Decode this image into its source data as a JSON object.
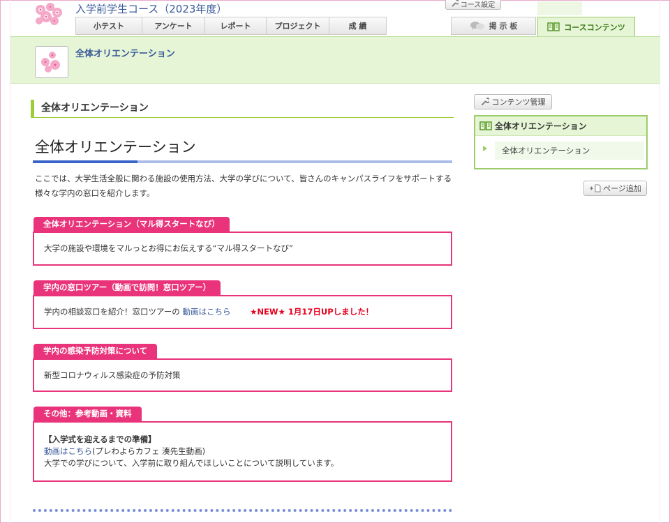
{
  "header": {
    "course_title": "入学前学生コース（2023年度）",
    "course_settings": "コース設定",
    "tabs": [
      {
        "label": "小テスト"
      },
      {
        "label": "アンケート"
      },
      {
        "label": "レポート"
      },
      {
        "label": "プロジェクト"
      },
      {
        "label": "成 績"
      }
    ],
    "board_tab": "掲 示 板",
    "contents_tab": "コースコンテンツ"
  },
  "band": {
    "title": "全体オリエンテーション"
  },
  "main": {
    "section_head": "全体オリエンテーション",
    "page_title": "全体オリエンテーション",
    "intro": "ここでは、大学生活全般に関わる施設の使用方法、大学の学びについて、皆さんのキャンパスライフをサポートする様々な学内の窓口を紹介します。",
    "boxes": [
      {
        "label": "全体オリエンテーション（マル得スタートなび）",
        "text": "大学の施設や環境をマルっとお得にお伝えする“マル得スタートなび”"
      },
      {
        "label": "学内の窓口ツアー（動画で訪問！窓口ツアー）",
        "text": "学内の相談窓口を紹介！窓口ツアーの",
        "link": "動画はこちら",
        "notice": "★NEW★ 1月17日UPしました！"
      },
      {
        "label": "学内の感染予防対策について",
        "text": "新型コロナウィルス感染症の予防対策"
      },
      {
        "label": "その他：参考動画・資料",
        "heading": "【入学式を迎えるまでの準備】",
        "link": "動画はこちら",
        "link_suffix": "(プレわよらカフェ 湊先生動画)",
        "text": "大学での学びについて、入学前に取り組んでほしいことについて説明しています。"
      }
    ]
  },
  "sidebar": {
    "manage_button": "コンテンツ管理",
    "box_title": "全体オリエンテーション",
    "item": "全体オリエンテーション",
    "add_page_button": "ページ追加"
  }
}
